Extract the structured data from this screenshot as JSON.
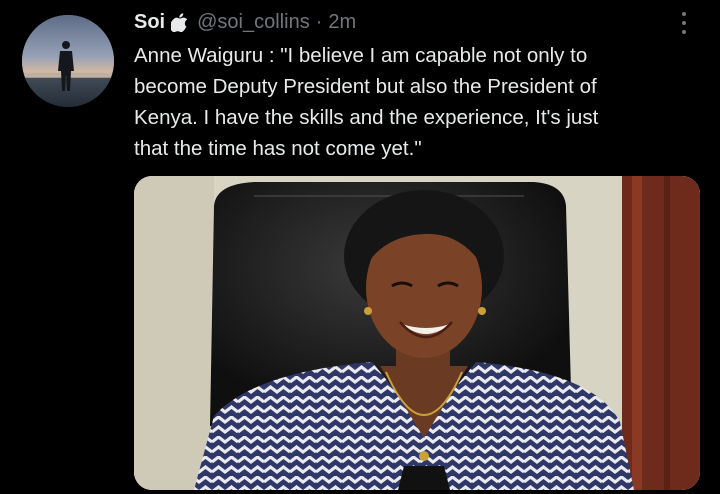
{
  "tweet": {
    "display_name": "Soi",
    "name_emoji_icon": "apple-icon",
    "handle": "@soi_collins",
    "separator": "·",
    "time": "2m",
    "more_icon": "more-vertical-icon",
    "text_lines": [
      "Anne Waiguru : \"I believe I am capable not only to",
      "become Deputy President but also the President of",
      "Kenya. I have the skills and the experience, It's just",
      "that the time has not come yet.\""
    ]
  },
  "colors": {
    "background": "#000000",
    "primary_text": "#e7e9ea",
    "secondary_text": "#71767b"
  }
}
